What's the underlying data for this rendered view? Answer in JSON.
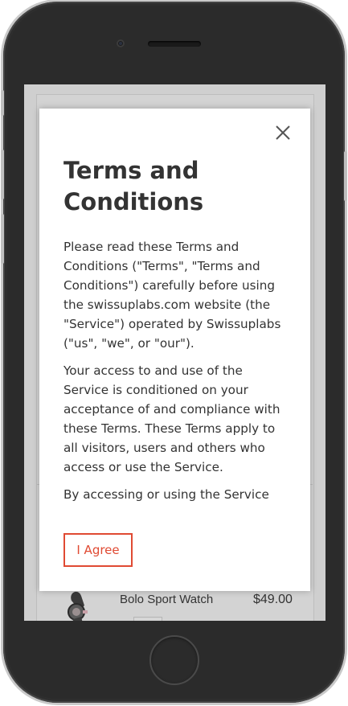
{
  "modal": {
    "title": "Terms and Conditions",
    "paragraphs": [
      "Please read these Terms and Conditions (\"Terms\", \"Terms and Conditions\") carefully before using the swissuplabs.com website (the \"Service\") operated by Swissuplabs (\"us\", \"we\", or \"our\").",
      "Your access to and use of the Service is conditioned on your acceptance of and compliance with these Terms. These Terms apply to all visitors, users and others who access or use the Service.",
      "By accessing or using the Service you"
    ],
    "agree_label": "I Agree",
    "close_icon": "close-icon"
  },
  "background_product": {
    "name": "Bolo Sport Watch",
    "price": "$49.00",
    "thumb_icon": "watch-icon"
  },
  "colors": {
    "accent": "#e04a33",
    "text": "#333333",
    "overlay": "#cfcfcf",
    "phone_frame": "#2e2e2e"
  }
}
